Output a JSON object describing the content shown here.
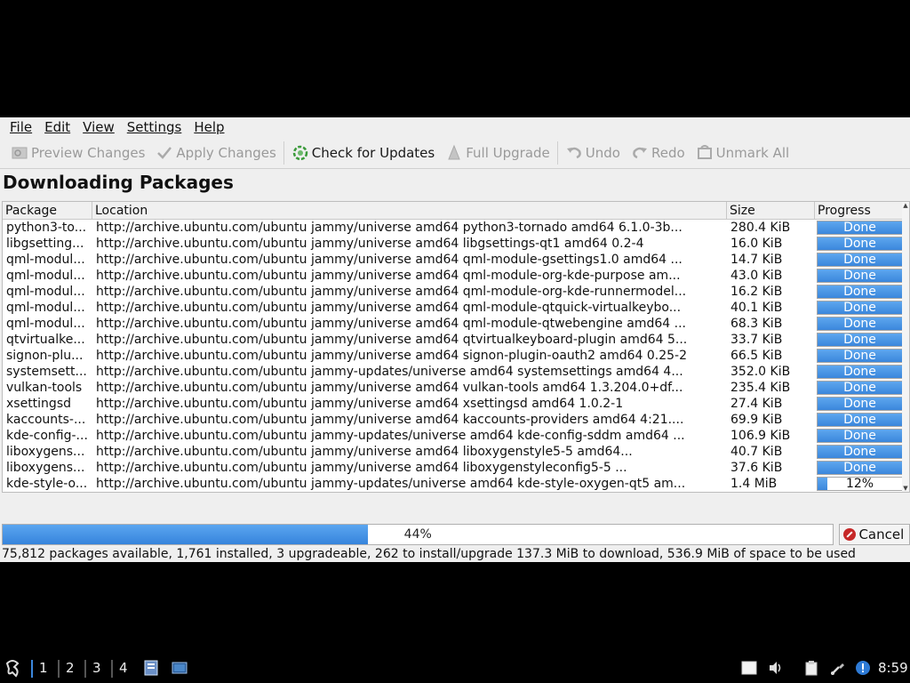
{
  "menu": [
    "File",
    "Edit",
    "View",
    "Settings",
    "Help"
  ],
  "toolbar": {
    "preview": "Preview Changes",
    "apply": "Apply Changes",
    "check": "Check for Updates",
    "upgrade": "Full Upgrade",
    "undo": "Undo",
    "redo": "Redo",
    "unmark": "Unmark All"
  },
  "heading": "Downloading Packages",
  "table": {
    "columns": [
      "Package",
      "Location",
      "Size",
      "Progress"
    ],
    "rows": [
      {
        "pkg": "python3-to...",
        "loc": "http://archive.ubuntu.com/ubuntu jammy/universe amd64 python3-tornado amd64 6.1.0-3b...",
        "size": "280.4 KiB",
        "progress": "Done",
        "fraction": 1.0
      },
      {
        "pkg": "libgsetting...",
        "loc": "http://archive.ubuntu.com/ubuntu jammy/universe amd64 libgsettings-qt1 amd64 0.2-4",
        "size": "16.0 KiB",
        "progress": "Done",
        "fraction": 1.0
      },
      {
        "pkg": "qml-modul...",
        "loc": "http://archive.ubuntu.com/ubuntu jammy/universe amd64 qml-module-gsettings1.0 amd64 ...",
        "size": "14.7 KiB",
        "progress": "Done",
        "fraction": 1.0
      },
      {
        "pkg": "qml-modul...",
        "loc": "http://archive.ubuntu.com/ubuntu jammy/universe amd64 qml-module-org-kde-purpose am...",
        "size": "43.0 KiB",
        "progress": "Done",
        "fraction": 1.0
      },
      {
        "pkg": "qml-modul...",
        "loc": "http://archive.ubuntu.com/ubuntu jammy/universe amd64 qml-module-org-kde-runnermodel...",
        "size": "16.2 KiB",
        "progress": "Done",
        "fraction": 1.0
      },
      {
        "pkg": "qml-modul...",
        "loc": "http://archive.ubuntu.com/ubuntu jammy/universe amd64 qml-module-qtquick-virtualkeybo...",
        "size": "40.1 KiB",
        "progress": "Done",
        "fraction": 1.0
      },
      {
        "pkg": "qml-modul...",
        "loc": "http://archive.ubuntu.com/ubuntu jammy/universe amd64 qml-module-qtwebengine amd64 ...",
        "size": "68.3 KiB",
        "progress": "Done",
        "fraction": 1.0
      },
      {
        "pkg": "qtvirtualke...",
        "loc": "http://archive.ubuntu.com/ubuntu jammy/universe amd64 qtvirtualkeyboard-plugin amd64 5...",
        "size": "33.7 KiB",
        "progress": "Done",
        "fraction": 1.0
      },
      {
        "pkg": "signon-plu...",
        "loc": "http://archive.ubuntu.com/ubuntu jammy/universe amd64 signon-plugin-oauth2 amd64 0.25-2",
        "size": "66.5 KiB",
        "progress": "Done",
        "fraction": 1.0
      },
      {
        "pkg": "systemsett...",
        "loc": "http://archive.ubuntu.com/ubuntu jammy-updates/universe amd64 systemsettings amd64 4...",
        "size": "352.0 KiB",
        "progress": "Done",
        "fraction": 1.0
      },
      {
        "pkg": "vulkan-tools",
        "loc": "http://archive.ubuntu.com/ubuntu jammy/universe amd64 vulkan-tools amd64 1.3.204.0+df...",
        "size": "235.4 KiB",
        "progress": "Done",
        "fraction": 1.0
      },
      {
        "pkg": "xsettingsd",
        "loc": "http://archive.ubuntu.com/ubuntu jammy/universe amd64 xsettingsd amd64 1.0.2-1",
        "size": "27.4 KiB",
        "progress": "Done",
        "fraction": 1.0
      },
      {
        "pkg": "kaccounts-...",
        "loc": "http://archive.ubuntu.com/ubuntu jammy/universe amd64 kaccounts-providers amd64 4:21....",
        "size": "69.9 KiB",
        "progress": "Done",
        "fraction": 1.0
      },
      {
        "pkg": "kde-config-...",
        "loc": "http://archive.ubuntu.com/ubuntu jammy-updates/universe amd64 kde-config-sddm amd64 ...",
        "size": "106.9 KiB",
        "progress": "Done",
        "fraction": 1.0
      },
      {
        "pkg": "liboxygens...",
        "loc": "http://archive.ubuntu.com/ubuntu jammy/universe amd64 liboxygenstyle5-5 amd64...",
        "size": "40.7 KiB",
        "progress": "Done",
        "fraction": 1.0
      },
      {
        "pkg": "liboxygens...",
        "loc": "http://archive.ubuntu.com/ubuntu jammy/universe amd64 liboxygenstyleconfig5-5 ...",
        "size": "37.6 KiB",
        "progress": "Done",
        "fraction": 1.0
      },
      {
        "pkg": "kde-style-o...",
        "loc": "http://archive.ubuntu.com/ubuntu jammy-updates/universe amd64 kde-style-oxygen-qt5 am...",
        "size": "1.4 MiB",
        "progress": "12%",
        "fraction": 0.12
      }
    ]
  },
  "overall": {
    "label": "44%",
    "fraction": 0.44
  },
  "cancel_label": "Cancel",
  "status": "75,812 packages available, 1,761 installed, 3 upgradeable, 262 to install/upgrade 137.3 MiB to download, 536.9 MiB of space to be used",
  "taskbar": {
    "workspaces": [
      "1",
      "2",
      "3",
      "4"
    ],
    "clock": "8:59",
    "icons": [
      "start-menu-icon",
      "file-manager-icon",
      "terminal-icon",
      "window-icon",
      "volume-icon",
      "clipboard-icon",
      "network-icon",
      "update-notifier-icon"
    ]
  },
  "colors": {
    "accent": "#3b87dc",
    "cancel": "#c62828"
  }
}
